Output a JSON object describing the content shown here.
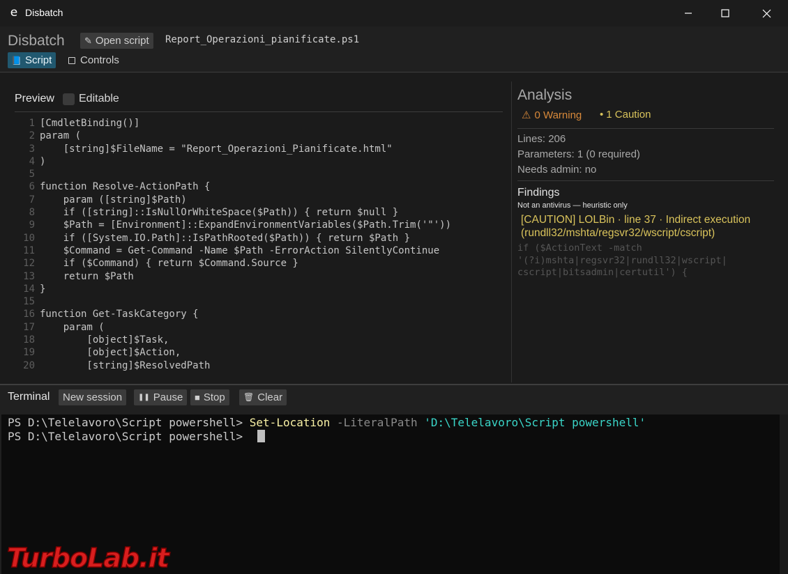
{
  "window": {
    "app_icon": "e",
    "title": "Disbatch",
    "controls": [
      "minimize-icon",
      "maximize-icon",
      "close-icon"
    ]
  },
  "header": {
    "brand": "Disbatch",
    "open_script_label": "Open script",
    "open_script_icon": "✎",
    "file_name": "Report_Operazioni_pianificate.ps1",
    "tabs": [
      {
        "label": "Script",
        "icon": "📘",
        "active": true
      },
      {
        "label": "Controls",
        "icon": "square-icon",
        "active": false
      }
    ]
  },
  "preview": {
    "label": "Preview",
    "editable_label": "Editable",
    "editable_checked": false,
    "lines": [
      {
        "n": "1",
        "text": "[CmdletBinding()]"
      },
      {
        "n": "2",
        "text": "param ("
      },
      {
        "n": "3",
        "text": "    [string]$FileName = \"Report_Operazioni_Pianificate.html\""
      },
      {
        "n": "4",
        "text": ")"
      },
      {
        "n": "5",
        "text": ""
      },
      {
        "n": "6",
        "text": "function Resolve-ActionPath {"
      },
      {
        "n": "7",
        "text": "    param ([string]$Path)"
      },
      {
        "n": "8",
        "text": "    if ([string]::IsNullOrWhiteSpace($Path)) { return $null }"
      },
      {
        "n": "9",
        "text": "    $Path = [Environment]::ExpandEnvironmentVariables($Path.Trim('\"'))"
      },
      {
        "n": "10",
        "text": "    if ([System.IO.Path]::IsPathRooted($Path)) { return $Path }"
      },
      {
        "n": "11",
        "text": "    $Command = Get-Command -Name $Path -ErrorAction SilentlyContinue"
      },
      {
        "n": "12",
        "text": "    if ($Command) { return $Command.Source }"
      },
      {
        "n": "13",
        "text": "    return $Path"
      },
      {
        "n": "14",
        "text": "}"
      },
      {
        "n": "15",
        "text": ""
      },
      {
        "n": "16",
        "text": "function Get-TaskCategory {"
      },
      {
        "n": "17",
        "text": "    param ("
      },
      {
        "n": "18",
        "text": "        [object]$Task,"
      },
      {
        "n": "19",
        "text": "        [object]$Action,"
      },
      {
        "n": "20",
        "text": "        [string]$ResolvedPath"
      }
    ]
  },
  "analysis": {
    "title": "Analysis",
    "warning_icon": "⚠",
    "warning_text": "0 Warning",
    "caution_icon": "•",
    "caution_text": "1 Caution",
    "lines": "Lines: 206",
    "parameters": "Parameters: 1 (0 required)",
    "needs_admin": "Needs admin: no",
    "findings_title": "Findings",
    "findings_subtitle": "Not an antivirus — heuristic only",
    "finding_text": "[CAUTION] LOLBin · line 37 · Indirect execution (rundll32/mshta/regsvr32/wscript/cscript)",
    "finding_code": "if ($ActionText -match\n'(?i)mshta|regsvr32|rundll32|wscript|\ncscript|bitsadmin|certutil') {"
  },
  "terminal": {
    "label": "Terminal",
    "buttons": [
      {
        "label": "New session",
        "icon": ""
      },
      {
        "label": "Pause",
        "icon": "❚❚"
      },
      {
        "label": "Stop",
        "icon": "■"
      },
      {
        "label": "Clear",
        "icon": "🗑"
      }
    ],
    "line1": {
      "prompt": "PS D:\\Telelavoro\\Script powershell> ",
      "command": "Set-Location",
      "param": " -LiteralPath ",
      "string": "'D:\\Telelavoro\\Script powershell'"
    },
    "line2_prompt": "PS D:\\Telelavoro\\Script powershell> "
  },
  "watermark": {
    "text": "TurboLab.it"
  },
  "colors": {
    "accent_tab": "#21586f",
    "warning": "#d8893a",
    "caution": "#d9c35b",
    "terminal_cmd": "#f9f1a5",
    "terminal_string": "#3ad5c8"
  }
}
